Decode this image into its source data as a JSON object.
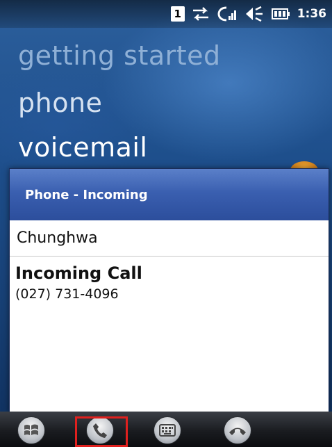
{
  "status_bar": {
    "sim_number": "1",
    "icons": [
      "sim-indicator-icon",
      "data-transfer-icon",
      "signal-strength-icon",
      "speaker-icon",
      "battery-icon"
    ],
    "time": "1:36"
  },
  "home_menu": {
    "items": [
      "getting started",
      "phone",
      "voicemail"
    ]
  },
  "dialog": {
    "title": "Phone - Incoming",
    "caller_name": "Chunghwa",
    "call_title": "Incoming Call",
    "phone_number": "(027) 731-4096"
  },
  "taskbar": {
    "buttons": [
      "windows-start-icon",
      "answer-call-icon",
      "keyboard-icon",
      "end-call-icon"
    ],
    "highlighted": "answer-call-icon"
  },
  "colors": {
    "dialog_header": "#3a5fb0",
    "highlight": "#e0201e",
    "background": "#1f4e86"
  }
}
